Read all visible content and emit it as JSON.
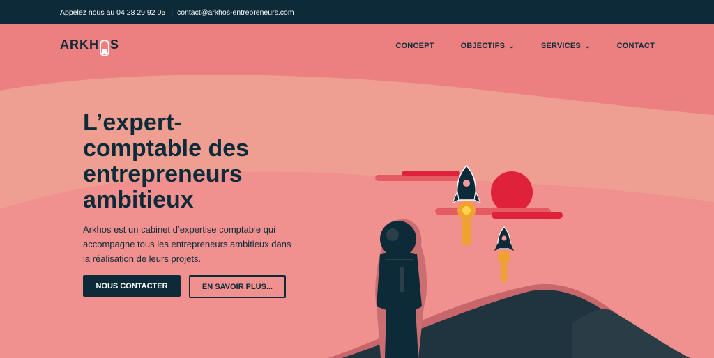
{
  "topbar": {
    "phone_text": "Appelez nous au 04 28 29 92 05",
    "separator": "|",
    "email_text": "contact@arkhos-entrepreneurs.com"
  },
  "brand": {
    "logo_left": "ARKH",
    "logo_right": "S"
  },
  "nav": {
    "items": [
      {
        "label": "CONCEPT",
        "has_dropdown": false
      },
      {
        "label": "OBJECTIFS",
        "has_dropdown": true
      },
      {
        "label": "SERVICES",
        "has_dropdown": true
      },
      {
        "label": "CONTACT",
        "has_dropdown": false
      }
    ],
    "chevron": "⌄"
  },
  "hero": {
    "title_lines": [
      "L’expert-",
      "comptable des",
      "entrepreneurs",
      "ambitieux"
    ],
    "description": "Arkhos est un cabinet d’expertise comptable qui accompagne tous les entrepreneurs ambitieux dans la réalisation de leurs projets.",
    "primary_button": "NOUS CONTACTER",
    "secondary_button": "EN SAVOIR PLUS..."
  },
  "colors": {
    "navy": "#0d2a38",
    "salmon": "#f0918f",
    "light_band": "#ee9f92",
    "top_band": "#ec8080",
    "red_sun": "#e0213a",
    "orange_flame": "#f0a132"
  }
}
